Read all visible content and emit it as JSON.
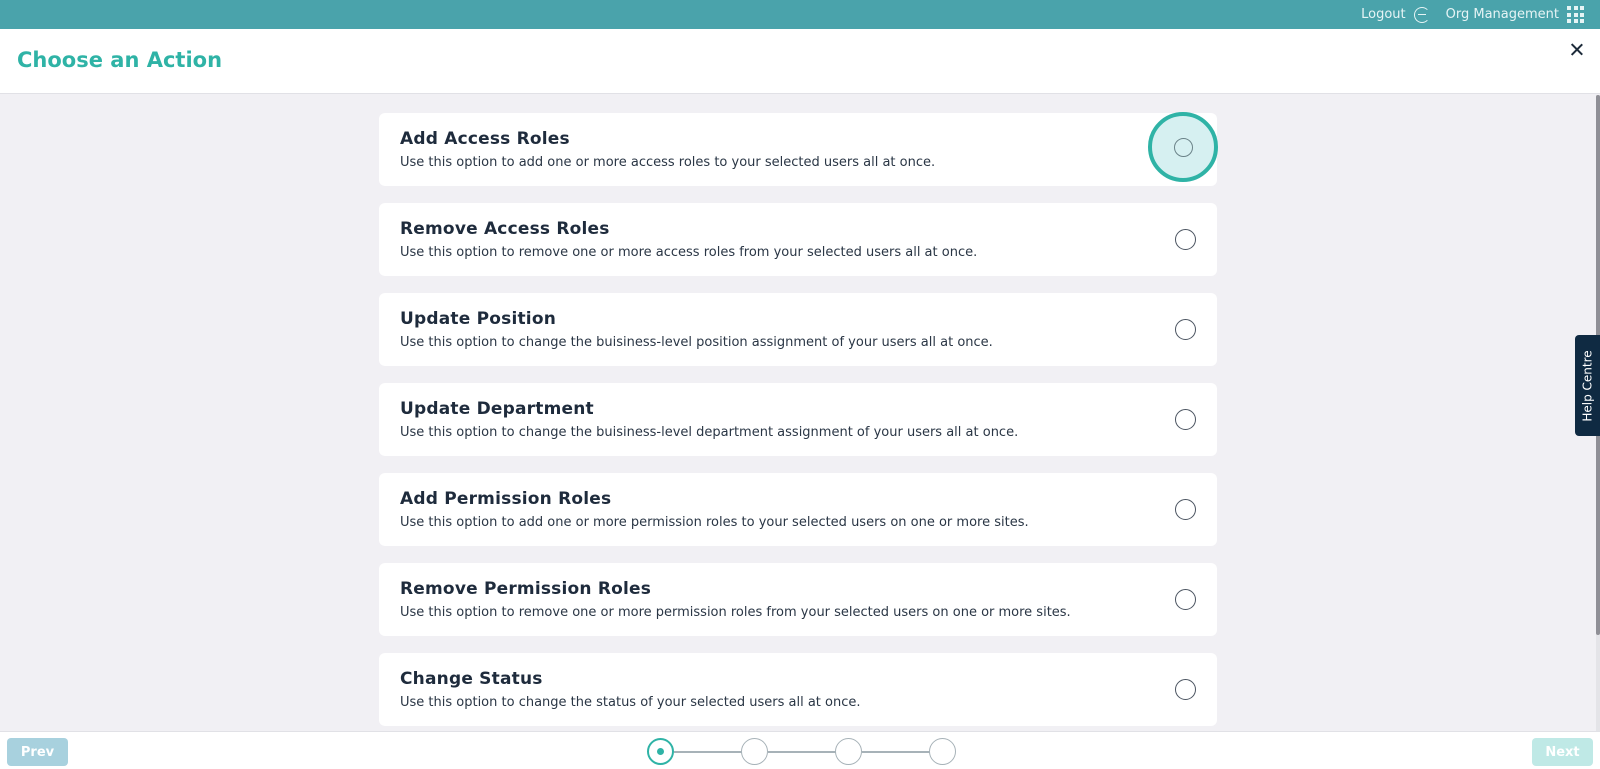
{
  "topbar": {
    "logout_label": "Logout",
    "org_label": "Org Management",
    "icons": [
      "logout-icon",
      "apps-grid-icon"
    ]
  },
  "header": {
    "title": "Choose an Action",
    "close_icon": "close-icon"
  },
  "options": [
    {
      "title": "Add Access Roles",
      "description": "Use this option to add one or more access roles to your selected users all at once.",
      "selected": false,
      "focused": true
    },
    {
      "title": "Remove Access Roles",
      "description": "Use this option to remove one or more access roles from your selected users all at once.",
      "selected": false
    },
    {
      "title": "Update Position",
      "description": "Use this option to change the buisiness-level position assignment of your users all at once.",
      "selected": false
    },
    {
      "title": "Update Department",
      "description": "Use this option to change the buisiness-level department assignment of your users all at once.",
      "selected": false
    },
    {
      "title": "Add Permission Roles",
      "description": "Use this option to add one or more permission roles to your selected users on one or more sites.",
      "selected": false
    },
    {
      "title": "Remove Permission Roles",
      "description": "Use this option to remove one or more permission roles from your selected users on one or more sites.",
      "selected": false
    },
    {
      "title": "Change Status",
      "description": "Use this option to change the status of your selected users all at once.",
      "selected": false
    }
  ],
  "help_tab": {
    "label": "Help Centre"
  },
  "footer": {
    "prev_label": "Prev",
    "next_label": "Next",
    "steps_total": 4,
    "current_step": 1
  },
  "colors": {
    "topbar": "#4aa3ab",
    "accent": "#2fb3a6",
    "help_tab": "#0f2a42",
    "background": "#f1f0f4"
  }
}
